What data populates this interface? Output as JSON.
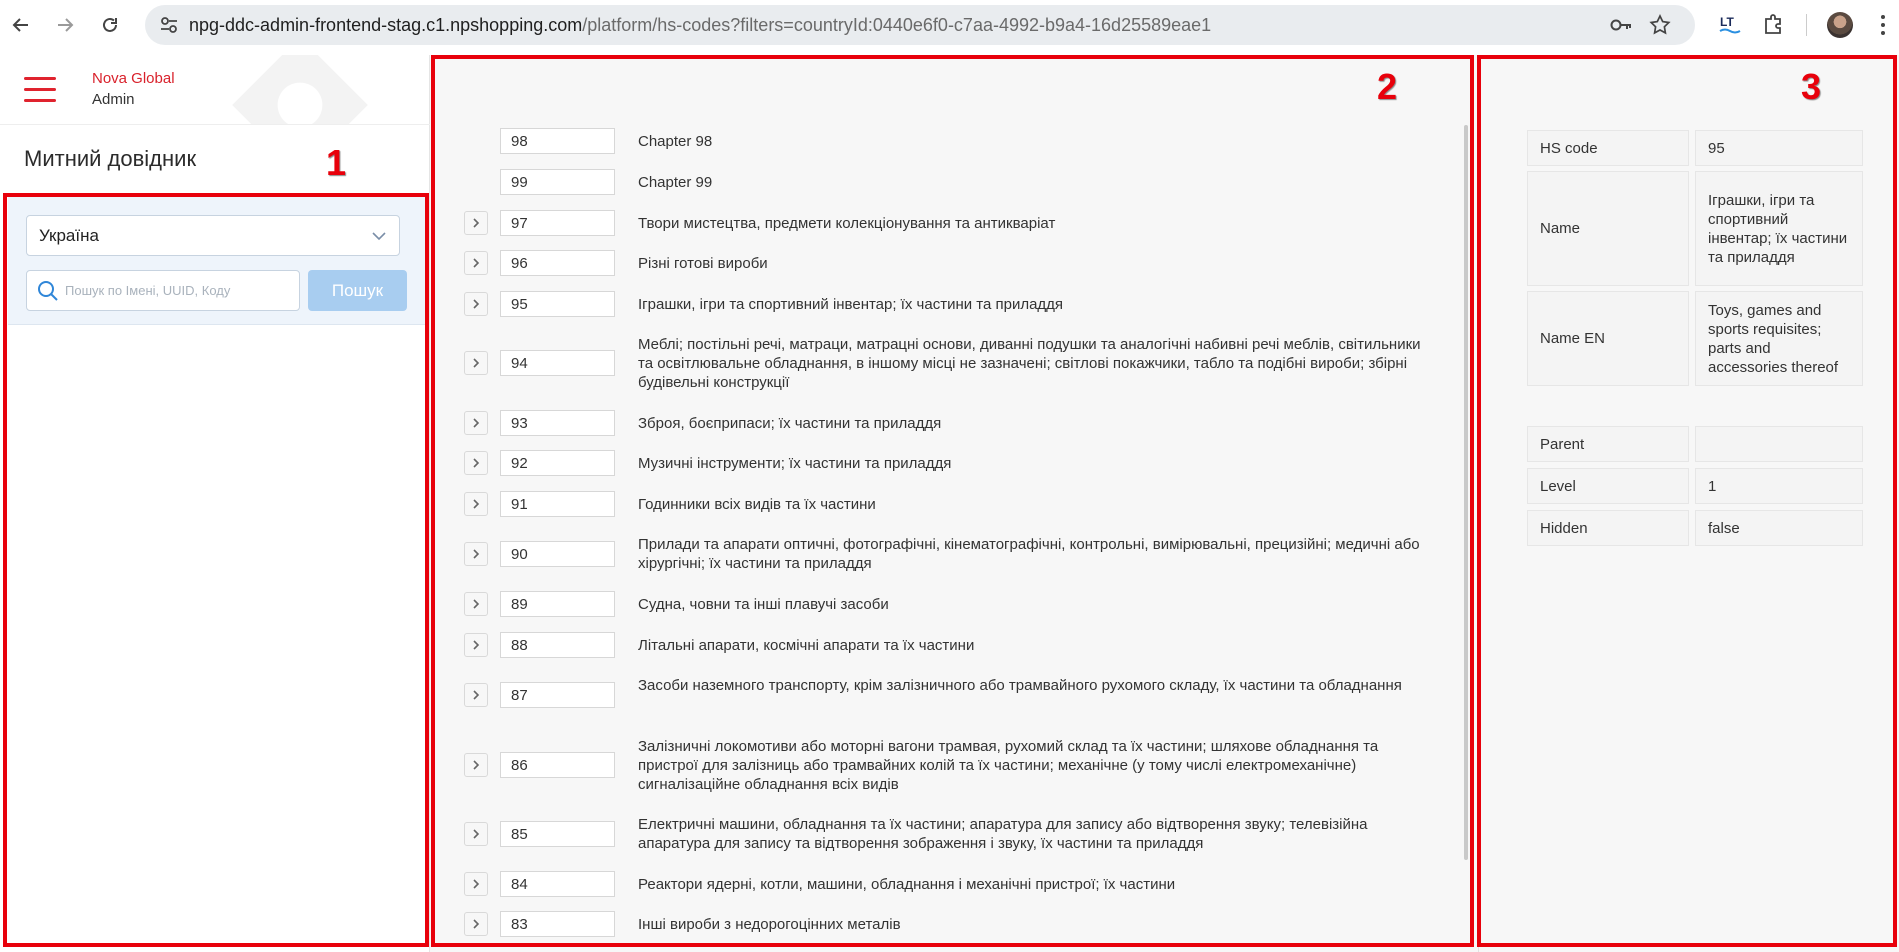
{
  "browser": {
    "url_host": "npg-ddc-admin-frontend-stag.c1.npshopping.com",
    "url_path": "/platform/hs-codes?filters=countryId:0440e6f0-c7aa-4992-b9a4-16d25589eae1",
    "icons": [
      "back-arrow-icon",
      "forward-arrow-icon",
      "reload-icon",
      "site-info-icon",
      "key-icon",
      "star-icon",
      "translate-extension-icon",
      "puzzle-extension-icon",
      "profile-avatar",
      "more-vert-icon"
    ]
  },
  "sidebar": {
    "brand_line1": "Nova Global",
    "brand_line2": "Admin",
    "page_title": "Митний довідник",
    "country_value": "Україна",
    "search_placeholder": "Пошук по Імені, UUID, Коду",
    "search_button": "Пошук"
  },
  "tree": {
    "rows": [
      {
        "code": "98",
        "name": "Chapter 98",
        "expandable": false
      },
      {
        "code": "99",
        "name": "Chapter 99",
        "expandable": false
      },
      {
        "code": "97",
        "name": "Твори мистецтва, предмети колекціонування та антикваріат",
        "expandable": true
      },
      {
        "code": "96",
        "name": "Різні готові вироби",
        "expandable": true
      },
      {
        "code": "95",
        "name": "Іграшки, ігри та спортивний інвентар; їх частини та приладдя",
        "expandable": true
      },
      {
        "code": "94",
        "name": "Меблі; постільні речі, матраци, матрацні основи, диванні подушки та аналогічні набивні речі меблів, світильники та освітлювальне обладнання, в іншому місці не зазначені; світлові покажчики, табло та подібні вироби; збірні будівельні конструкції",
        "expandable": true
      },
      {
        "code": "93",
        "name": "Зброя, боєприпаси; їх частини та приладдя",
        "expandable": true
      },
      {
        "code": "92",
        "name": "Музичні інструменти; їх частини та приладдя",
        "expandable": true
      },
      {
        "code": "91",
        "name": "Годинники всіх видів та їх частини",
        "expandable": true
      },
      {
        "code": "90",
        "name": "Прилади та апарати оптичні, фотографічні, кінематографічні, контрольні, вимірювальні, прецизійні; медичні або хірургічні; їх частини та приладдя",
        "expandable": true
      },
      {
        "code": "89",
        "name": "Судна, човни та інші плавучі засоби",
        "expandable": true
      },
      {
        "code": "88",
        "name": "Літальні апарати, космічні апарати та їх частини",
        "expandable": true
      },
      {
        "code": "87",
        "name": "Засоби наземного транспорту, крім залізничного або трамвайного рухомого складу, їх частини та обладнання",
        "expandable": true
      },
      {
        "code": "86",
        "name": "Залізничні локомотиви або моторні вагони трамвая, рухомий склад та їх частини; шляхове обладнання та пристрої для залізниць або трамвайних колій та їх частини; механічне (у тому числі електромеханічне) сигналізаційне обладнання всіх видів",
        "expandable": true
      },
      {
        "code": "85",
        "name": "Електричні машини, обладнання та їх частини; апаратура для запису або відтворення звуку; телевізійна апаратура для запису та відтворення зображення і звуку, їх частини та приладдя",
        "expandable": true
      },
      {
        "code": "84",
        "name": "Реактори ядерні, котли, машини, обладнання і механічні пристрої; їх частини",
        "expandable": true
      },
      {
        "code": "83",
        "name": "Інші вироби з недорогоцінних металів",
        "expandable": true
      }
    ]
  },
  "details": {
    "hs_code_label": "HS code",
    "hs_code_value": "95",
    "name_label": "Name",
    "name_value": "Іграшки, ігри та спортивний інвентар; їх частини та приладдя",
    "name_en_label": "Name EN",
    "name_en_value": "Toys, games and sports requisites; parts and accessories thereof",
    "parent_label": "Parent",
    "parent_value": "",
    "level_label": "Level",
    "level_value": "1",
    "hidden_label": "Hidden",
    "hidden_value": "false"
  },
  "annotations": {
    "label1": "1",
    "label2": "2",
    "label3": "3",
    "color": "#e8000b"
  }
}
